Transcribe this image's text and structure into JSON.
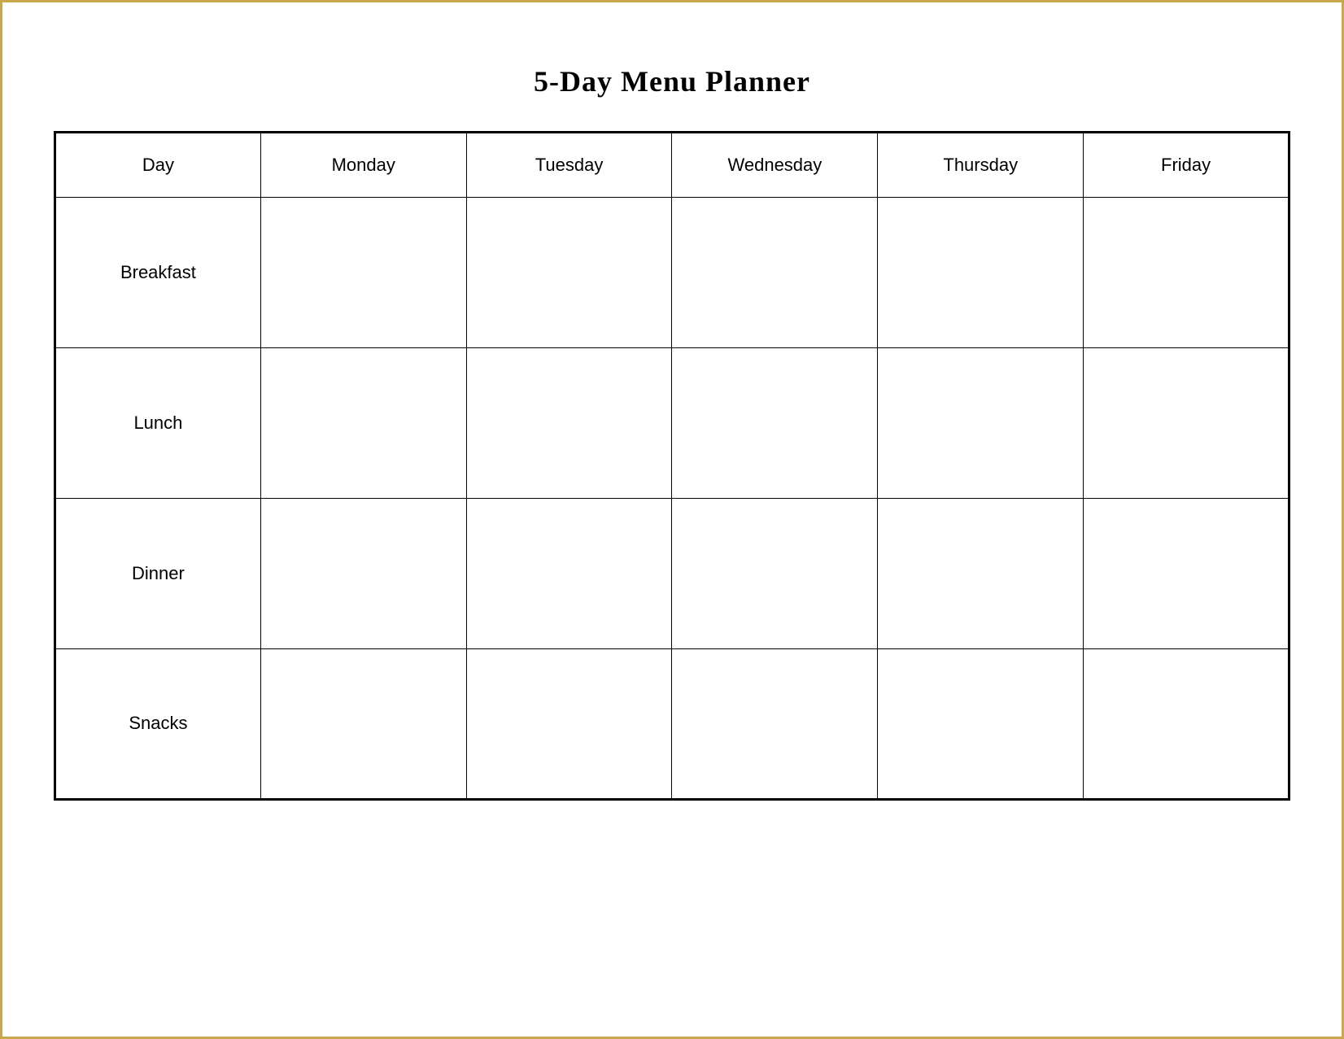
{
  "title": "5-Day Menu Planner",
  "columns": {
    "day": "Day",
    "monday": "Monday",
    "tuesday": "Tuesday",
    "wednesday": "Wednesday",
    "thursday": "Thursday",
    "friday": "Friday"
  },
  "rows": [
    {
      "label": "Breakfast"
    },
    {
      "label": "Lunch"
    },
    {
      "label": "Dinner"
    },
    {
      "label": "Snacks"
    }
  ]
}
